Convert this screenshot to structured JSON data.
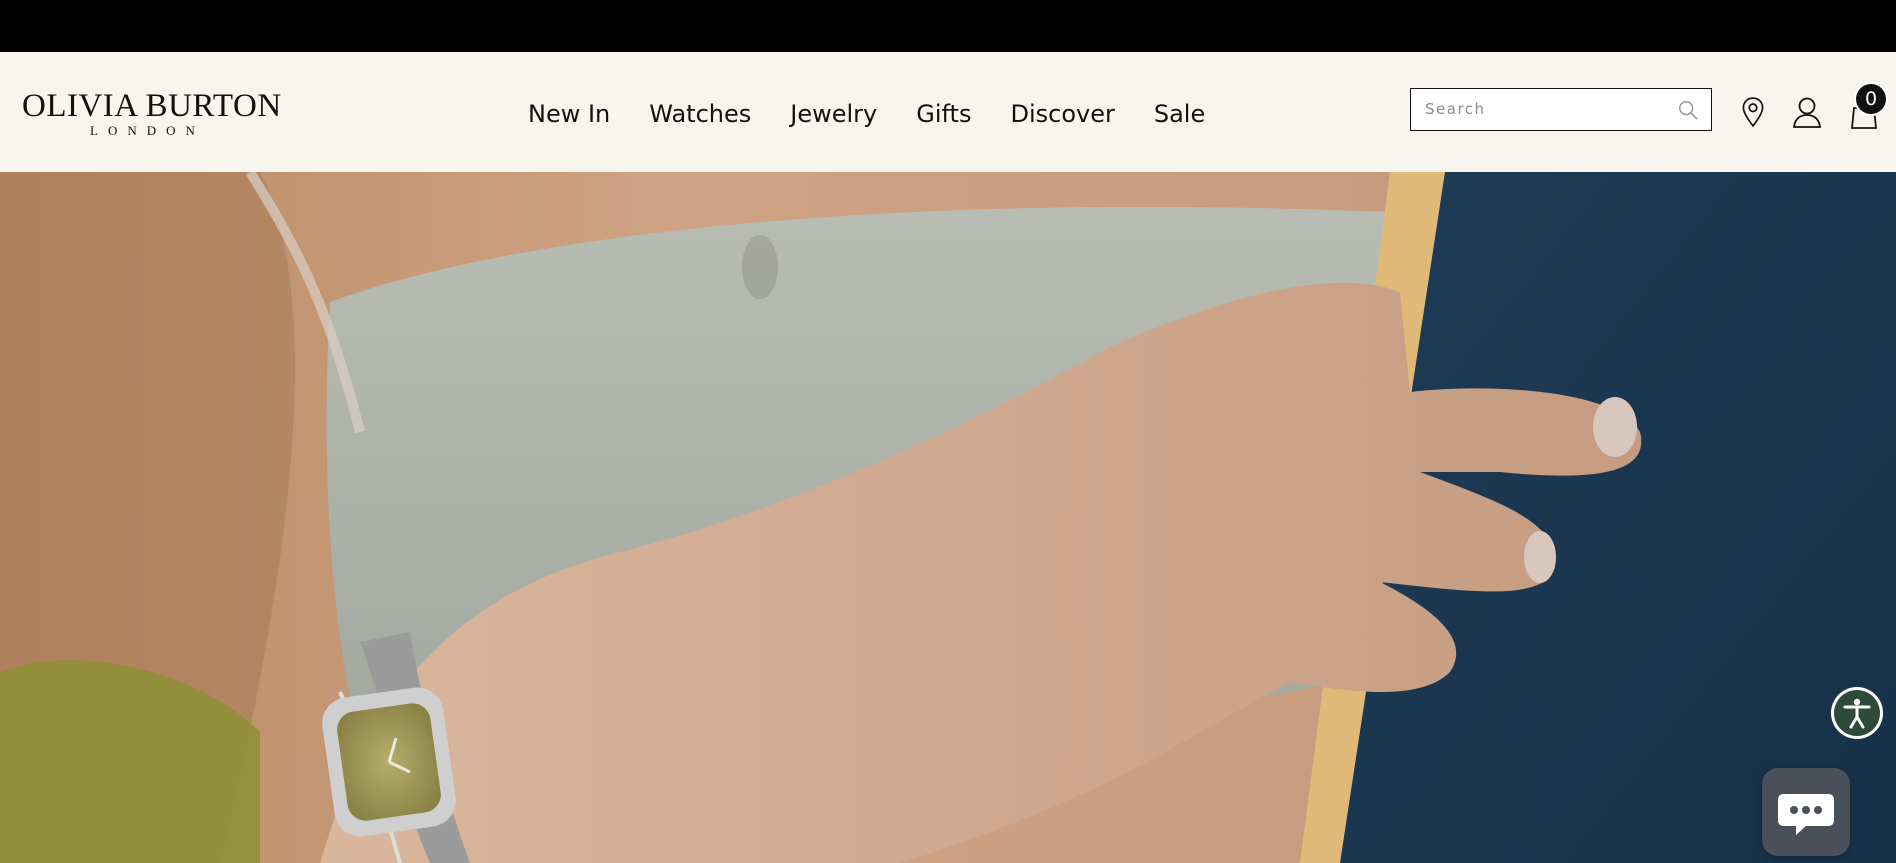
{
  "brand": {
    "name": "OLIVIA BURTON",
    "subtitle": "LONDON"
  },
  "nav": {
    "items": [
      "New In",
      "Watches",
      "Jewelry",
      "Gifts",
      "Discover",
      "Sale"
    ]
  },
  "search": {
    "placeholder": "Search",
    "value": ""
  },
  "icons": {
    "search": "search-icon",
    "store": "location-pin-icon",
    "account": "user-icon",
    "bag": "shopping-bag-icon",
    "accessibility": "accessibility-icon",
    "chat": "chat-icon"
  },
  "cart": {
    "count": "0"
  },
  "colors": {
    "topbar": "#000000",
    "header_bg": "#f8f5ef",
    "text": "#111111",
    "accessibility_btn": "#2e4a3b",
    "chat_btn": "#4a4f5a"
  }
}
